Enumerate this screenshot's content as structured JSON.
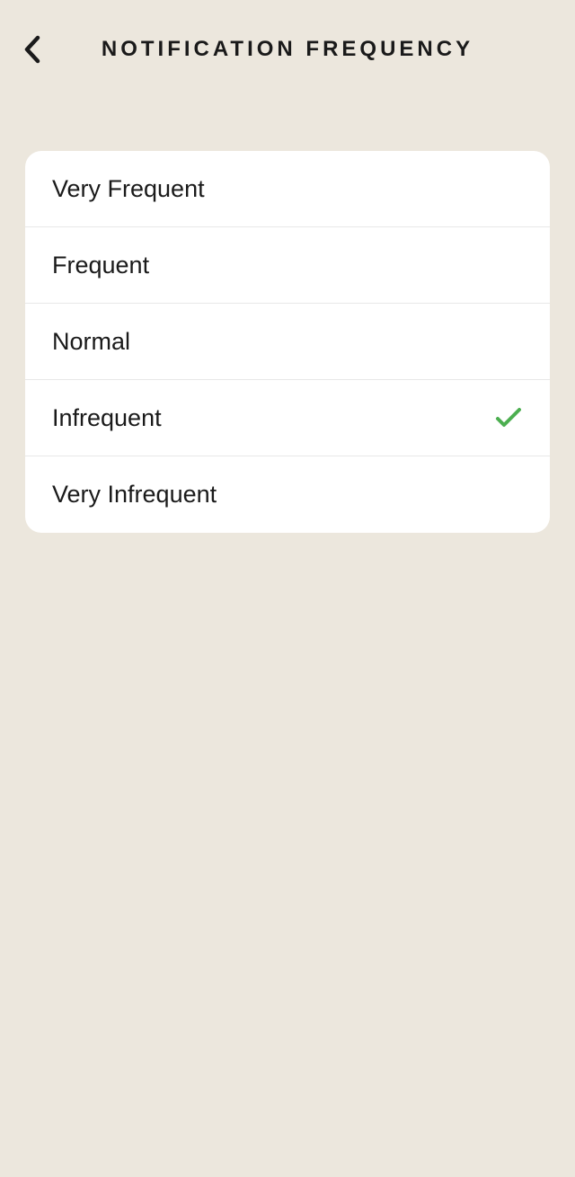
{
  "header": {
    "title": "NOTIFICATION FREQUENCY"
  },
  "options": [
    {
      "label": "Very Frequent",
      "selected": false
    },
    {
      "label": "Frequent",
      "selected": false
    },
    {
      "label": "Normal",
      "selected": false
    },
    {
      "label": "Infrequent",
      "selected": true
    },
    {
      "label": "Very Infrequent",
      "selected": false
    }
  ],
  "colors": {
    "background": "#ece7dd",
    "card": "#ffffff",
    "text": "#1a1a1a",
    "check": "#4caf50",
    "divider": "#e8e8e8"
  }
}
